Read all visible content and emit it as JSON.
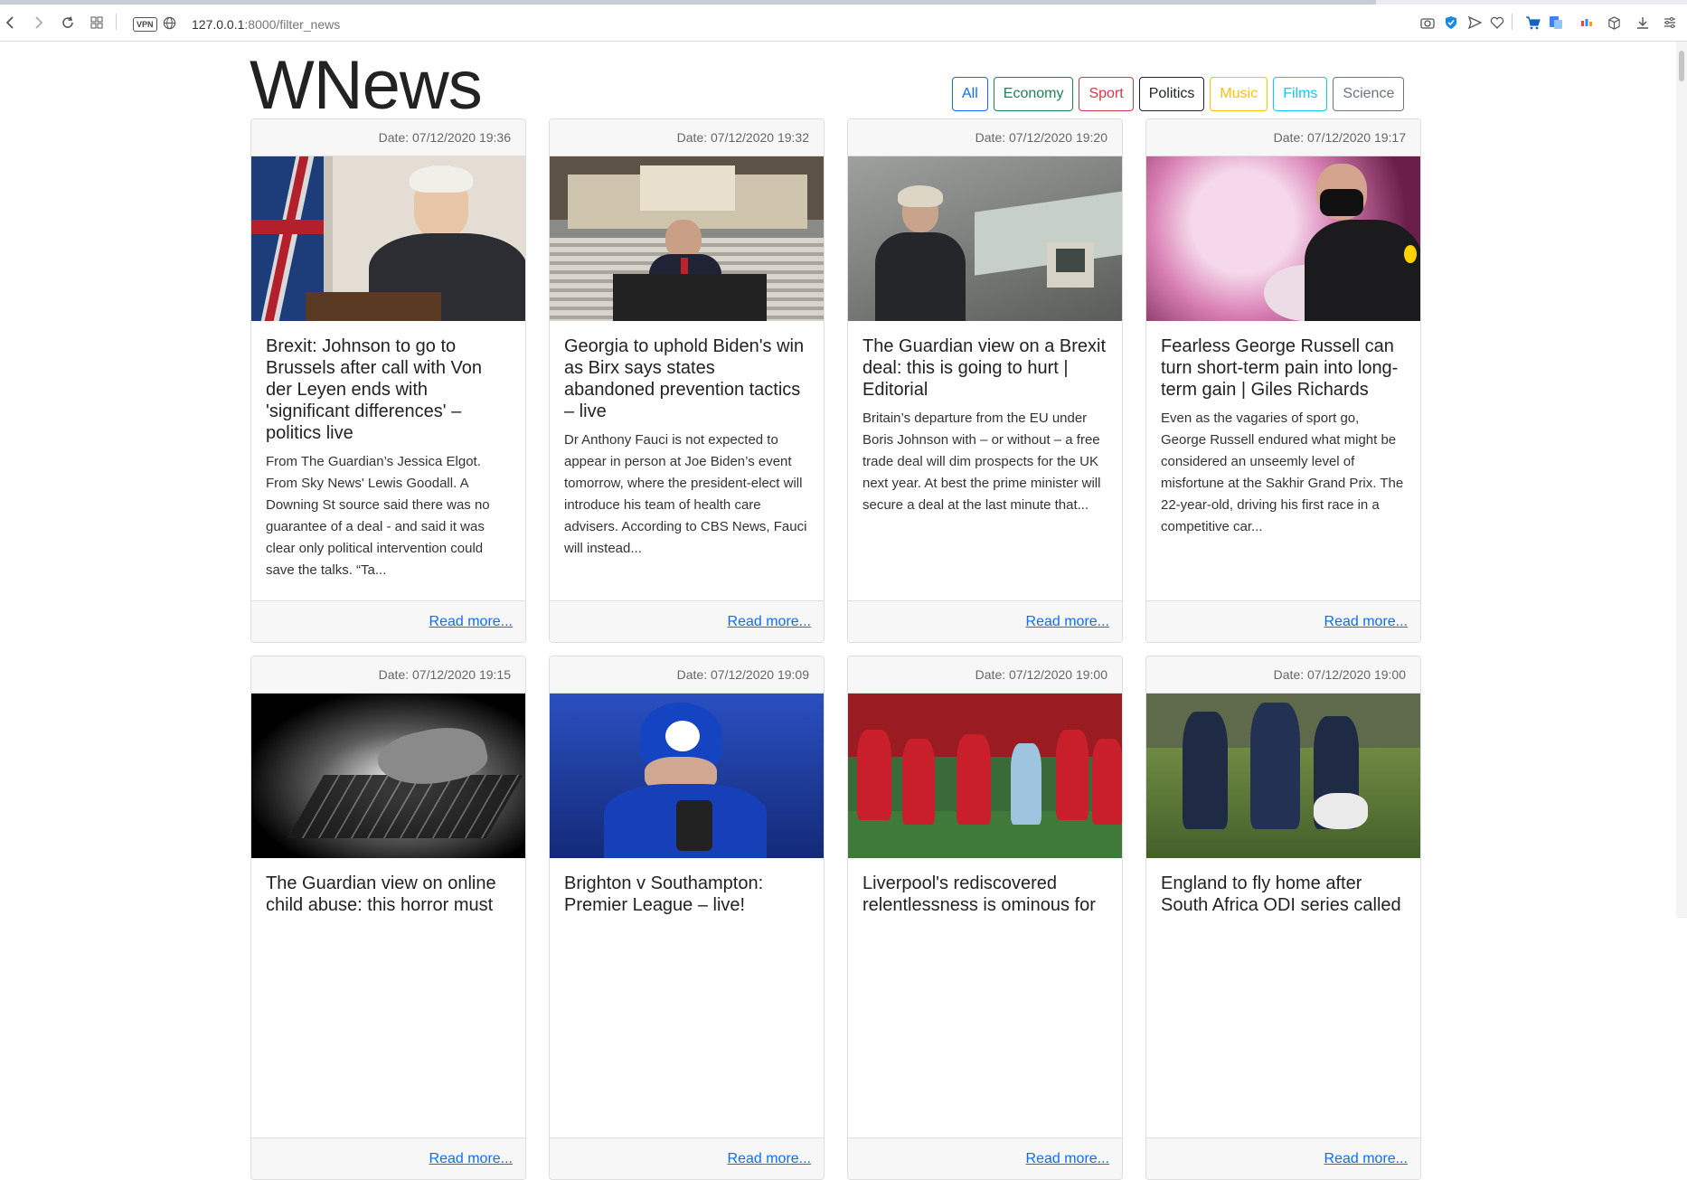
{
  "browser": {
    "vpn_label": "VPN",
    "url_host": "127.0.0.1",
    "url_rest": ":8000/filter_news"
  },
  "site": {
    "logo": "WNews"
  },
  "filters": [
    {
      "label": "All",
      "color": "#0d6efd"
    },
    {
      "label": "Economy",
      "color": "#198754"
    },
    {
      "label": "Sport",
      "color": "#dc3545"
    },
    {
      "label": "Politics",
      "color": "#212529"
    },
    {
      "label": "Music",
      "color": "#ffc107"
    },
    {
      "label": "Films",
      "color": "#0dcaf0"
    },
    {
      "label": "Science",
      "color": "#6c757d"
    }
  ],
  "read_more_label": "Read more...",
  "articles": [
    {
      "date": "Date: 07/12/2020 19:36",
      "title": "Brexit: Johnson to go to Brussels after call with Von der Leyen ends with 'significant differences' – politics live",
      "summary": "From The Guardian’s Jessica Elgot. From Sky News' Lewis Goodall. A Downing St source said there was no guarantee of a deal - and said it was clear only political intervention could save the talks. “Ta..."
    },
    {
      "date": "Date: 07/12/2020 19:32",
      "title": "Georgia to uphold Biden's win as Birx says states abandoned prevention tactics – live",
      "summary": "Dr Anthony Fauci is not expected to appear in person at Joe Biden’s event tomorrow, where the president-elect will introduce his team of health care advisers. According to CBS News, Fauci will instead..."
    },
    {
      "date": "Date: 07/12/2020 19:20",
      "title": "The Guardian view on a Brexit deal: this is going to hurt | Editorial",
      "summary": "Britain’s departure from the EU under Boris Johnson with – or without – a free trade deal will dim prospects for the UK next year. At best the prime minister will secure a deal at the last minute that..."
    },
    {
      "date": "Date: 07/12/2020 19:17",
      "title": "Fearless George Russell can turn short-term pain into long-term gain | Giles Richards",
      "summary": "Even as the vagaries of sport go, George Russell endured what might be considered an unseemly level of misfortune at the Sakhir Grand Prix. The 22-year-old, driving his first race in a competitive car..."
    },
    {
      "date": "Date: 07/12/2020 19:15",
      "title": "The Guardian view on online child abuse: this horror must",
      "summary": ""
    },
    {
      "date": "Date: 07/12/2020 19:09",
      "title": "Brighton v Southampton: Premier League – live!",
      "summary": ""
    },
    {
      "date": "Date: 07/12/2020 19:00",
      "title": "Liverpool's rediscovered relentlessness is ominous for",
      "summary": ""
    },
    {
      "date": "Date: 07/12/2020 19:00",
      "title": "England to fly home after South Africa ODI series called",
      "summary": ""
    }
  ]
}
